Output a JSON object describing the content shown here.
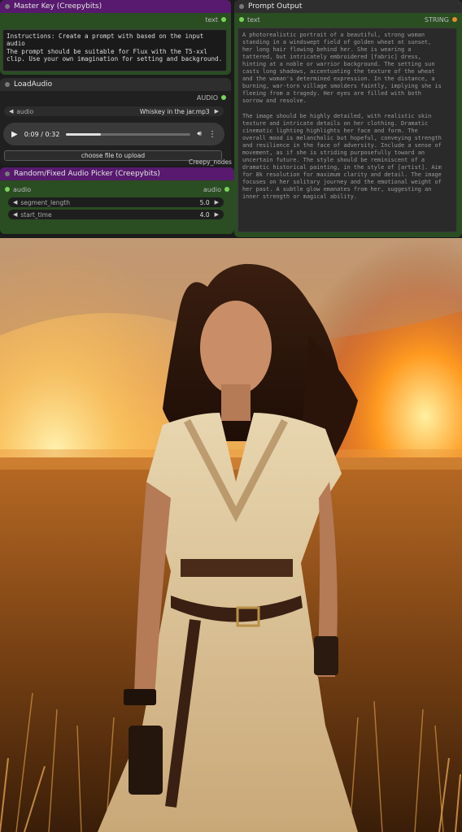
{
  "master_key": {
    "title": "Master Key (Creepybits)",
    "output_label": "text",
    "prompt": "Instructions: Create a prompt with based on the input audio\nThe prompt should be suitable for Flux with the T5-xxl\nclip. Use your own imagination for setting and background."
  },
  "load_audio": {
    "title": "LoadAudio",
    "output_label": "AUDIO",
    "audio_widget_label": "audio",
    "audio_file": "Whiskey in the jar.mp3",
    "time": "0:09 / 0:32",
    "progress": 0.28,
    "upload_label": "choose file to upload",
    "footer_tag": "Creepy_nodes"
  },
  "picker": {
    "title": "Random/Fixed Audio Picker (Creepybits)",
    "input_label": "audio",
    "output_label": "audio",
    "segment_label": "segment_length",
    "segment_value": "5.0",
    "start_label": "start_time",
    "start_value": "4.0"
  },
  "prompt_output": {
    "title": "Prompt Output",
    "input_label": "text",
    "type_label": "STRING",
    "text": "A photorealistic portrait of a beautiful, strong woman\nstanding in a windswept field of golden wheat at sunset,\nher long hair flowing behind her. She is wearing a\ntattered, but intricately embroidered [fabric] dress,\nhinting at a noble or warrior background. The setting sun\ncasts long shadows, accentuating the texture of the wheat\nand the woman's determined expression. In the distance, a\nburning, war-torn village smolders faintly, implying she is\nfleeing from a tragedy. Her eyes are filled with both\nsorrow and resolve.\n\nThe image should be highly detailed, with realistic skin\ntexture and intricate details on her clothing. Dramatic\ncinematic lighting highlights her face and form. The\noverall mood is melancholic but hopeful, conveying strength\nand resilience in the face of adversity. Include a sense of\nmovement, as if she is striding purposefully toward an\nuncertain future. The style should be reminiscent of a\ndramatic historical painting, in the style of [artist]. Aim\nfor 8k resolution for maximum clarity and detail. The image\nfocuses on her solitary journey and the emotional weight of\nher past. A subtle glow emanates from her, suggesting an\ninner strength or magical ability."
  },
  "colors": {
    "node_green": "#2a4d22",
    "node_purple_header": "#571a6e",
    "slot_green": "#7bd35b",
    "slot_orange": "#e88b2e"
  }
}
